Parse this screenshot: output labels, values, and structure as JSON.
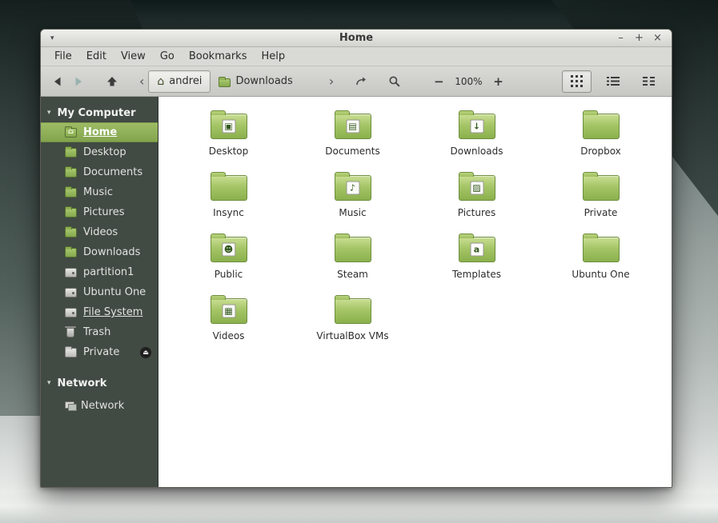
{
  "icons": {
    "caret": "▾",
    "home": "⌂",
    "eject": "⏏"
  },
  "window": {
    "title": "Home",
    "minimize_label": "–",
    "maximize_label": "+",
    "close_label": "×"
  },
  "menubar": {
    "items": [
      {
        "label": "File"
      },
      {
        "label": "Edit"
      },
      {
        "label": "View"
      },
      {
        "label": "Go"
      },
      {
        "label": "Bookmarks"
      },
      {
        "label": "Help"
      }
    ]
  },
  "toolbar": {
    "chevron_left": "‹",
    "chevron_right": "›",
    "breadcrumb_home": "andrei",
    "breadcrumb_current": "Downloads",
    "zoom_out_label": "−",
    "zoom_level": "100%",
    "zoom_in_label": "+"
  },
  "sidebar": {
    "sections": [
      {
        "header": "My Computer",
        "items": [
          {
            "label": "Home"
          },
          {
            "label": "Desktop"
          },
          {
            "label": "Documents"
          },
          {
            "label": "Music"
          },
          {
            "label": "Pictures"
          },
          {
            "label": "Videos"
          },
          {
            "label": "Downloads"
          },
          {
            "label": "partition1"
          },
          {
            "label": "Ubuntu One"
          },
          {
            "label": "File System"
          },
          {
            "label": "Trash"
          },
          {
            "label": "Private"
          }
        ]
      },
      {
        "header": "Network",
        "items": [
          {
            "label": "Network"
          }
        ]
      }
    ]
  },
  "main": {
    "folders": [
      {
        "name": "Desktop",
        "emblem": "display-emblem",
        "glyph": "▣"
      },
      {
        "name": "Documents",
        "emblem": "document-emblem",
        "glyph": "▤"
      },
      {
        "name": "Downloads",
        "emblem": "download-arrow-emblem",
        "glyph": "↓"
      },
      {
        "name": "Dropbox",
        "emblem": "",
        "glyph": ""
      },
      {
        "name": "Insync",
        "emblem": "",
        "glyph": ""
      },
      {
        "name": "Music",
        "emblem": "music-note-emblem",
        "glyph": "♪"
      },
      {
        "name": "Pictures",
        "emblem": "photos-emblem",
        "glyph": "▨"
      },
      {
        "name": "Private",
        "emblem": "",
        "glyph": ""
      },
      {
        "name": "Public",
        "emblem": "person-emblem",
        "glyph": "☻"
      },
      {
        "name": "Steam",
        "emblem": "",
        "glyph": ""
      },
      {
        "name": "Templates",
        "emblem": "template-emblem",
        "glyph": "a"
      },
      {
        "name": "Ubuntu One",
        "emblem": "",
        "glyph": ""
      },
      {
        "name": "Videos",
        "emblem": "film-emblem",
        "glyph": "▦"
      },
      {
        "name": "VirtualBox VMs",
        "emblem": "",
        "glyph": ""
      }
    ]
  },
  "colors": {
    "accent_green": "#8bb04d",
    "sidebar_bg": "#414a43",
    "selection_green": "#8fae57"
  }
}
